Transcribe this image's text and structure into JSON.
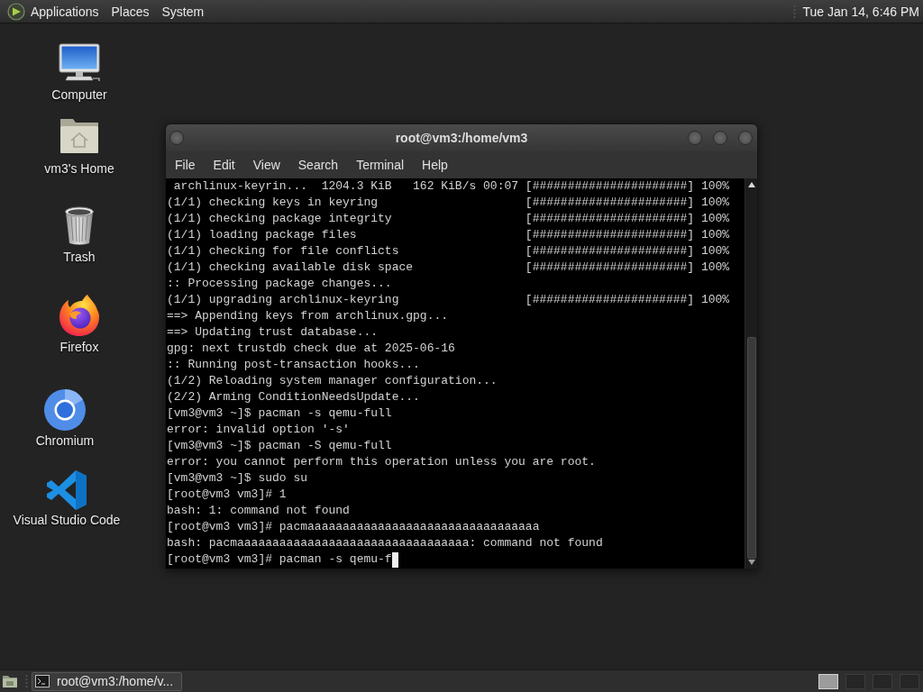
{
  "top_panel": {
    "menus": [
      "Applications",
      "Places",
      "System"
    ],
    "clock": "Tue Jan 14, 6:46 PM"
  },
  "desktop_icons": [
    {
      "label": "Computer",
      "kind": "computer"
    },
    {
      "label": "vm3's Home",
      "kind": "home_folder"
    },
    {
      "label": "Trash",
      "kind": "trash"
    },
    {
      "label": "Firefox",
      "kind": "firefox"
    },
    {
      "label": "Chromium",
      "kind": "chromium"
    },
    {
      "label": "Visual Studio Code",
      "kind": "code_editor"
    }
  ],
  "terminal_window": {
    "title": "root@vm3:/home/vm3",
    "menu": [
      "File",
      "Edit",
      "View",
      "Search",
      "Terminal",
      "Help"
    ],
    "lines": [
      {
        "text": " archlinux-keyrin...  1204.3 KiB   162 KiB/s 00:07",
        "progress": "[######################] 100%"
      },
      {
        "text": "(1/1) checking keys in keyring",
        "progress": "[######################] 100%"
      },
      {
        "text": "(1/1) checking package integrity",
        "progress": "[######################] 100%"
      },
      {
        "text": "(1/1) loading package files",
        "progress": "[######################] 100%"
      },
      {
        "text": "(1/1) checking for file conflicts",
        "progress": "[######################] 100%"
      },
      {
        "text": "(1/1) checking available disk space",
        "progress": "[######################] 100%"
      },
      {
        "text": ":: Processing package changes..."
      },
      {
        "text": "(1/1) upgrading archlinux-keyring",
        "progress": "[######################] 100%"
      },
      {
        "text": "==> Appending keys from archlinux.gpg..."
      },
      {
        "text": "==> Updating trust database..."
      },
      {
        "text": "gpg: next trustdb check due at 2025-06-16"
      },
      {
        "text": ":: Running post-transaction hooks..."
      },
      {
        "text": "(1/2) Reloading system manager configuration..."
      },
      {
        "text": "(2/2) Arming ConditionNeedsUpdate..."
      },
      {
        "text": "[vm3@vm3 ~]$ pacman -s qemu-full"
      },
      {
        "text": "error: invalid option '-s'"
      },
      {
        "text": "[vm3@vm3 ~]$ pacman -S qemu-full"
      },
      {
        "text": "error: you cannot perform this operation unless you are root."
      },
      {
        "text": "[vm3@vm3 ~]$ sudo su"
      },
      {
        "text": "[root@vm3 vm3]# 1"
      },
      {
        "text": "bash: 1: command not found"
      },
      {
        "text": "[root@vm3 vm3]# pacmaaaaaaaaaaaaaaaaaaaaaaaaaaaaaaaaa"
      },
      {
        "text": "bash: pacmaaaaaaaaaaaaaaaaaaaaaaaaaaaaaaaaa: command not found"
      },
      {
        "text": "[root@vm3 vm3]# pacman -s qemu-f"
      }
    ]
  },
  "bottom_panel": {
    "taskbar": [
      {
        "label": "root@vm3:/home/v..."
      }
    ],
    "workspaces": [
      {
        "selected": true
      },
      {
        "selected": false
      },
      {
        "selected": false
      },
      {
        "selected": false
      }
    ]
  }
}
